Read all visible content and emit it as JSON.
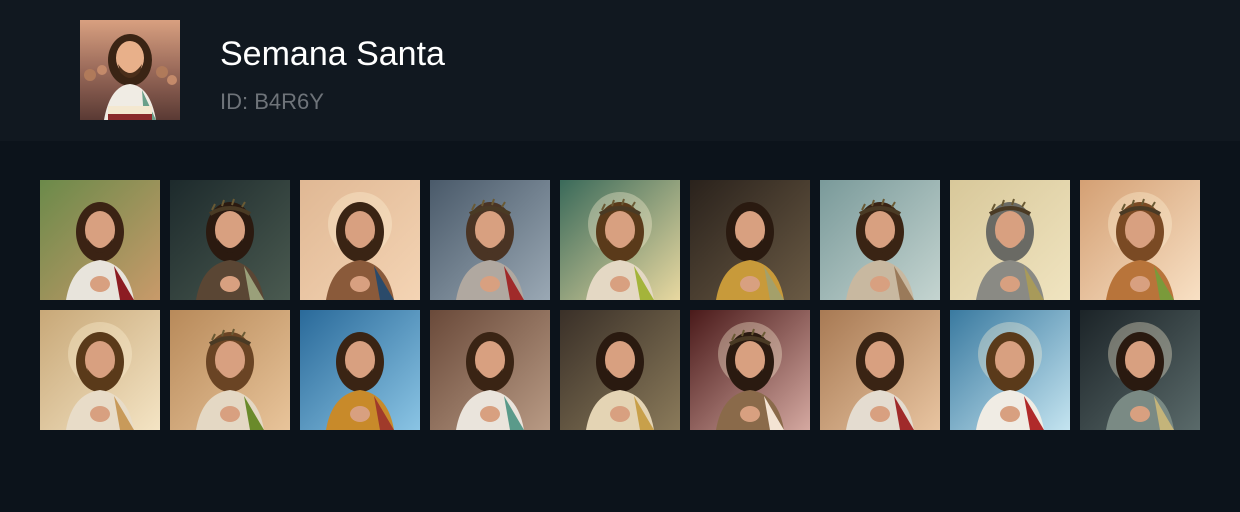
{
  "deck": {
    "title": "Semana Santa",
    "id_text": "ID: B4R6Y"
  },
  "thumbnails": [
    {
      "bg1": "#6b8a4a",
      "bg2": "#c89a6a",
      "robe": "#e8e4dc",
      "accent": "#8c1c22",
      "hair": "#3b2314",
      "crown": false,
      "halo": false
    },
    {
      "bg1": "#1d2a2c",
      "bg2": "#4a5a50",
      "robe": "#5a4634",
      "accent": "#9aa07a",
      "hair": "#2b1a10",
      "crown": true,
      "halo": false
    },
    {
      "bg1": "#e0b894",
      "bg2": "#f4d4b4",
      "robe": "#8a5a3a",
      "accent": "#2a4a6a",
      "hair": "#3a2414",
      "crown": false,
      "halo": true
    },
    {
      "bg1": "#4a5a6a",
      "bg2": "#9aa8b4",
      "robe": "#b0a8a0",
      "accent": "#a02a2a",
      "hair": "#4a3424",
      "crown": true,
      "halo": false
    },
    {
      "bg1": "#3a6a5a",
      "bg2": "#e8d8a0",
      "robe": "#e4d8c4",
      "accent": "#a4b43a",
      "hair": "#5a3a1a",
      "crown": true,
      "halo": true
    },
    {
      "bg1": "#2a221c",
      "bg2": "#6a5a44",
      "robe": "#c89a3a",
      "accent": "#a4a06a",
      "hair": "#2a1a10",
      "crown": false,
      "halo": false
    },
    {
      "bg1": "#7a9a9a",
      "bg2": "#c4d4d0",
      "robe": "#c8b8a0",
      "accent": "#9a7a5a",
      "hair": "#3a2414",
      "crown": true,
      "halo": false
    },
    {
      "bg1": "#d8c89a",
      "bg2": "#f0e4c0",
      "robe": "#8a8a84",
      "accent": "#a89a5a",
      "hair": "#6a6a64",
      "crown": true,
      "halo": false
    },
    {
      "bg1": "#d4a074",
      "bg2": "#f8e0c4",
      "robe": "#b8743a",
      "accent": "#7a9a3a",
      "hair": "#7a4a24",
      "crown": true,
      "halo": true
    },
    {
      "bg1": "#c8a878",
      "bg2": "#f4e4c4",
      "robe": "#e8dcc8",
      "accent": "#c89a5a",
      "hair": "#5a3a1a",
      "crown": false,
      "halo": true
    },
    {
      "bg1": "#b88a5a",
      "bg2": "#e8c49a",
      "robe": "#e4d8c4",
      "accent": "#6a8a2a",
      "hair": "#6a4424",
      "crown": true,
      "halo": false
    },
    {
      "bg1": "#2a6a9a",
      "bg2": "#8ac4e4",
      "robe": "#c88a2a",
      "accent": "#a03a2a",
      "hair": "#3a2414",
      "crown": false,
      "halo": false
    },
    {
      "bg1": "#6a4a3a",
      "bg2": "#b89a84",
      "robe": "#eae4dc",
      "accent": "#5a9a8a",
      "hair": "#3a2414",
      "crown": false,
      "halo": false
    },
    {
      "bg1": "#3a3028",
      "bg2": "#8a7a5a",
      "robe": "#e4d4b4",
      "accent": "#c8a04a",
      "hair": "#2a1a10",
      "crown": false,
      "halo": false
    },
    {
      "bg1": "#4a1a1a",
      "bg2": "#d4a8a0",
      "robe": "#8a6a4a",
      "accent": "#f4e4d4",
      "hair": "#2a1a10",
      "crown": true,
      "halo": true
    },
    {
      "bg1": "#a87a54",
      "bg2": "#e8c4a0",
      "robe": "#e4dcd0",
      "accent": "#a02a2a",
      "hair": "#3a2414",
      "crown": false,
      "halo": false
    },
    {
      "bg1": "#3a7aa0",
      "bg2": "#c4e4f0",
      "robe": "#f0ece4",
      "accent": "#b02a2a",
      "hair": "#5a3a1a",
      "crown": false,
      "halo": true
    },
    {
      "bg1": "#1c2428",
      "bg2": "#5a6a6a",
      "robe": "#7a8a84",
      "accent": "#c4b47a",
      "hair": "#2a1a10",
      "crown": false,
      "halo": true
    }
  ]
}
